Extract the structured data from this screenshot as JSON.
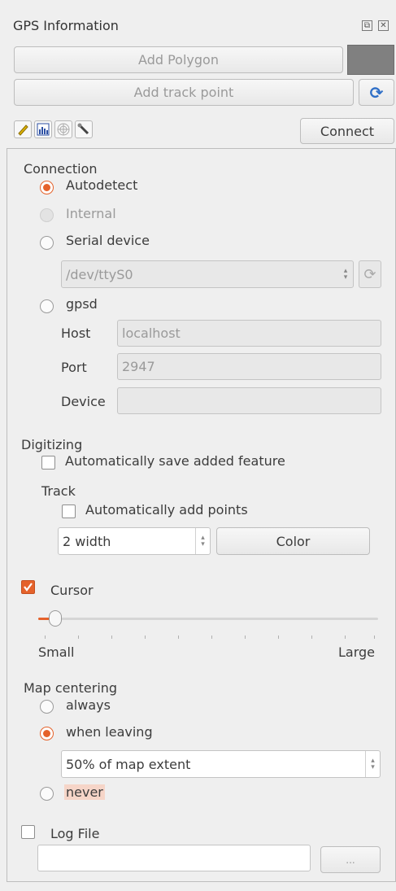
{
  "title": "GPS Information",
  "window_buttons": {
    "float": "⧉",
    "close": "✕"
  },
  "buttons": {
    "add_polygon": "Add Polygon",
    "add_track_point": "Add track point",
    "connect": "Connect"
  },
  "colors": {
    "accent": "#e5622b",
    "swatch": "#808080"
  },
  "connection": {
    "heading": "Connection",
    "autodetect": "Autodetect",
    "internal": "Internal",
    "serial": "Serial device",
    "serial_value": "/dev/ttyS0",
    "gpsd": "gpsd",
    "host_label": "Host",
    "host_value": "localhost",
    "port_label": "Port",
    "port_value": "2947",
    "device_label": "Device",
    "device_value": ""
  },
  "digitizing": {
    "heading": "Digitizing",
    "auto_save": "Automatically save added feature",
    "track_heading": "Track",
    "auto_add": "Automatically add points",
    "width_value": "2 width",
    "color_button": "Color"
  },
  "cursor": {
    "label": "Cursor",
    "checked": true,
    "small": "Small",
    "large": "Large",
    "slider_level": 0.05
  },
  "map_centering": {
    "heading": "Map centering",
    "always": "always",
    "when_leaving": "when leaving",
    "extent_value": "50% of map extent",
    "never": "never"
  },
  "log_file": {
    "label": "Log File",
    "path": "",
    "browse": "..."
  }
}
